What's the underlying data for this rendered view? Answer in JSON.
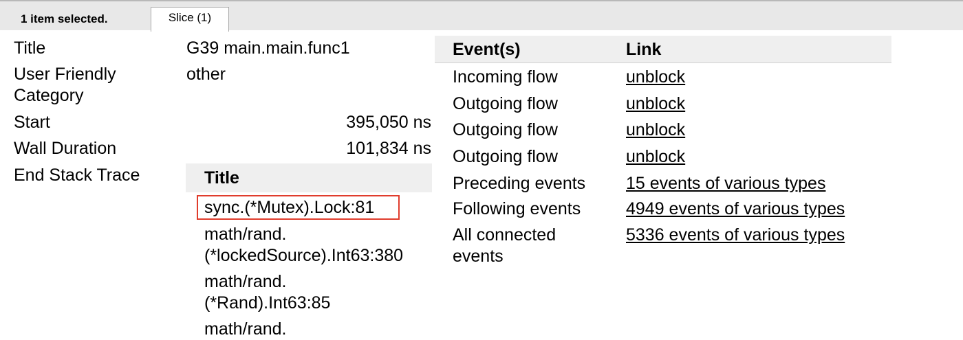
{
  "tabbar": {
    "status": "1 item selected.",
    "tab_label": "Slice (1)"
  },
  "properties": {
    "title_label": "Title",
    "title_value": "G39 main.main.func1",
    "category_label_line1": "User Friendly",
    "category_label_line2": "Category",
    "category_value": "other",
    "start_label": "Start",
    "start_value": "395,050 ns",
    "duration_label": "Wall Duration",
    "duration_value": "101,834 ns",
    "stack_label": "End Stack Trace"
  },
  "stack_trace": {
    "header": "Title",
    "frames": [
      {
        "line1": "sync.(*Mutex).Lock:81"
      },
      {
        "line1": "math/rand.",
        "line2": "(*lockedSource).Int63:380"
      },
      {
        "line1": "math/rand.",
        "line2": "(*Rand).Int63:85"
      },
      {
        "line1": "math/rand."
      }
    ]
  },
  "events": {
    "header_event": "Event(s)",
    "header_link": "Link",
    "rows": [
      {
        "name": "Incoming flow",
        "link": "unblock"
      },
      {
        "name": "Outgoing flow",
        "link": "unblock"
      },
      {
        "name": "Outgoing flow",
        "link": "unblock"
      },
      {
        "name": "Outgoing flow",
        "link": "unblock"
      },
      {
        "name": "Preceding events",
        "link": "15 events of various types"
      },
      {
        "name": "Following events",
        "link": "4949 events of various types"
      },
      {
        "name": "All connected",
        "name2": "events",
        "link": "5336 events of various types"
      }
    ]
  },
  "colors": {
    "highlight_border": "#e03c2c",
    "header_background": "#efefef"
  }
}
